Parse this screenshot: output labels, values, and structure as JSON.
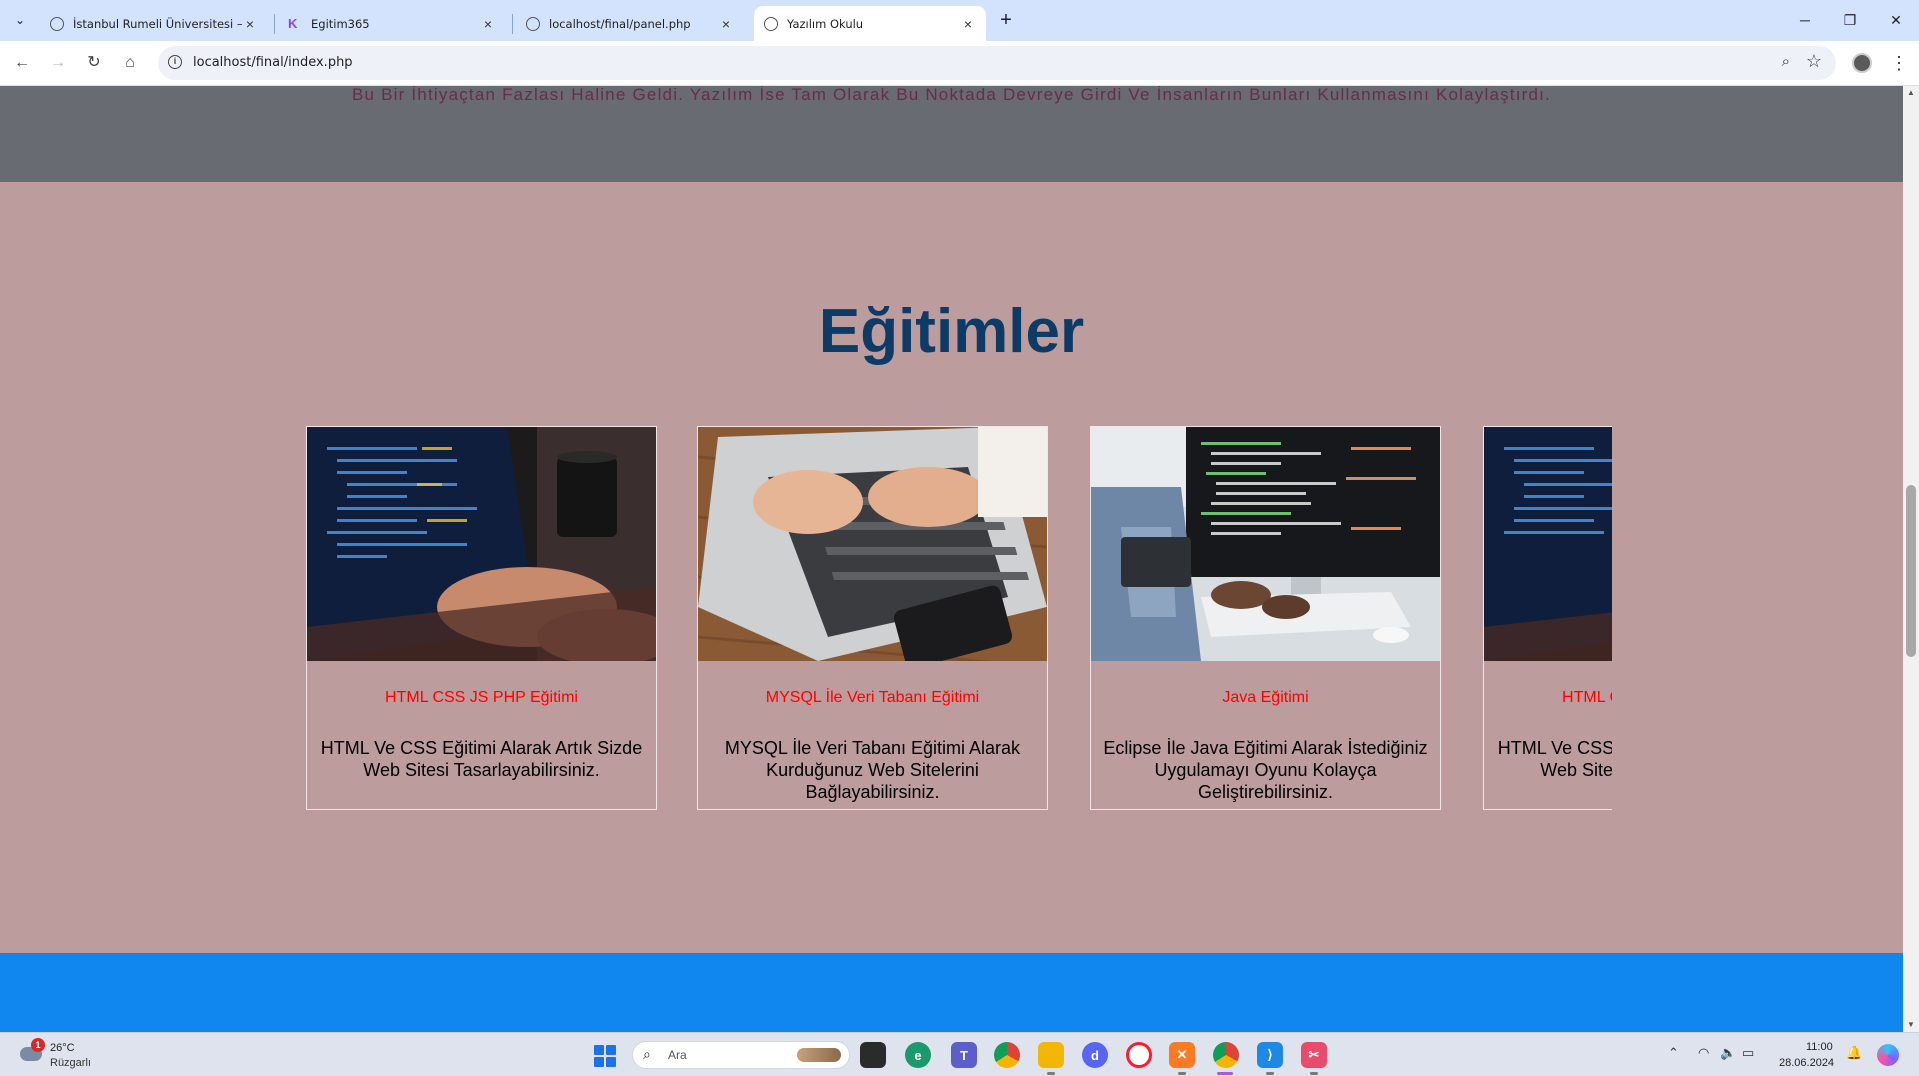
{
  "browser": {
    "tabs": [
      {
        "title": "İstanbul Rumeli Üniversitesi – U",
        "close": "×",
        "active": false
      },
      {
        "title": "Egitim365",
        "close": "×",
        "active": false
      },
      {
        "title": "localhost/final/panel.php",
        "close": "×",
        "active": false
      },
      {
        "title": "Yazılım Okulu",
        "close": "×",
        "active": true
      }
    ],
    "new_tab": "+",
    "address": "localhost/final/index.php"
  },
  "page": {
    "about_text": "Bu Bir İhtiyaçtan Fazlası Haline Geldi. Yazılım İse Tam Olarak Bu Noktada Devreye Girdi Ve İnsanların Bunları Kullanmasını Kolaylaştırdı.",
    "courses_title": "Eğitimler",
    "courses": [
      {
        "title": "HTML CSS JS PHP Eğitimi",
        "description": "HTML Ve CSS Eğitimi Alarak Artık Sizde Web Sitesi Tasarlayabilirsiniz."
      },
      {
        "title": "MYSQL İle Veri Tabanı Eğitimi",
        "description": "MYSQL İle Veri Tabanı Eğitimi Alarak Kurduğunuz Web Sitelerini Bağlayabilirsiniz."
      },
      {
        "title": "Java Eğitimi",
        "description": "Eclipse İle Java Eğitimi Alarak İstediğiniz Uygulamayı Oyunu Kolayça Geliştirebilirsiniz."
      },
      {
        "title": "HTML CSS JS PHP Eğitimi",
        "description": "HTML Ve CSS Eğitimi Alarak Artık Sizde Web Sitesi Tasarlayabilirsiniz."
      }
    ]
  },
  "taskbar": {
    "weather_badge": "1",
    "weather_temp": "26°C",
    "weather_desc": "Rüzgarlı",
    "search_placeholder": "Ara",
    "time": "11:00",
    "date": "28.06.2024",
    "apps": [
      "file-explorer",
      "edge",
      "teams",
      "chrome",
      "folders",
      "discord",
      "opera",
      "xampp",
      "chrome-active",
      "vscode",
      "snipping-tool"
    ]
  },
  "colors": {
    "about_bg": "#686b71",
    "courses_bg": "#bd9c9e",
    "title_color": "#0d3b66",
    "card_title_color": "#ff0000",
    "footer_bg": "#0f87ee"
  }
}
